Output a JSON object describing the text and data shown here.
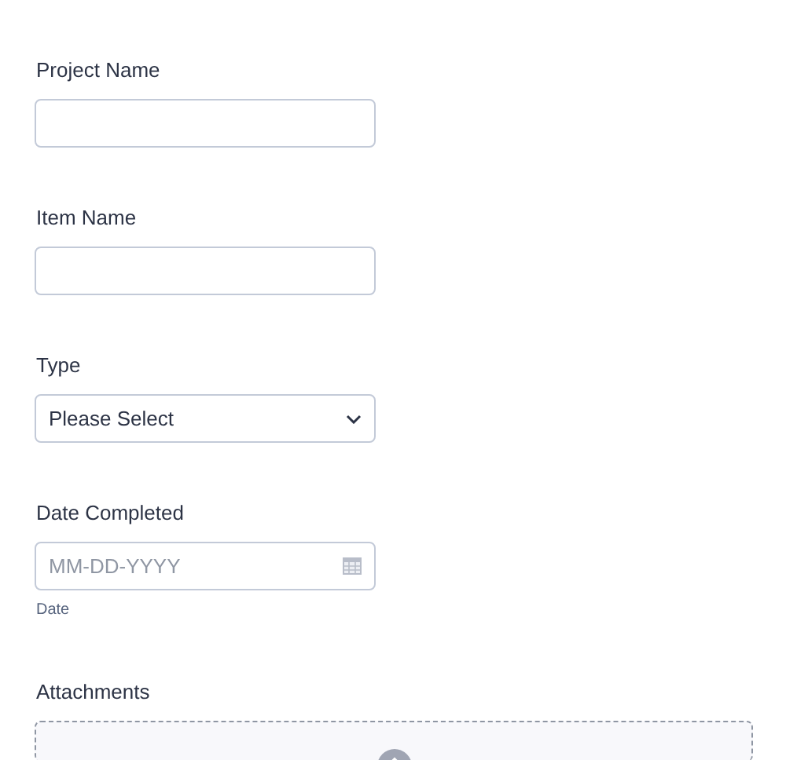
{
  "fields": [
    {
      "kind": "text",
      "label": "Project Name"
    },
    {
      "kind": "text",
      "label": "Item Name"
    },
    {
      "kind": "select",
      "label": "Type",
      "value": "Please Select"
    },
    {
      "kind": "date",
      "label": "Date Completed",
      "placeholder": "MM-DD-YYYY",
      "sublabel": "Date"
    },
    {
      "kind": "upload",
      "label": "Attachments"
    }
  ]
}
